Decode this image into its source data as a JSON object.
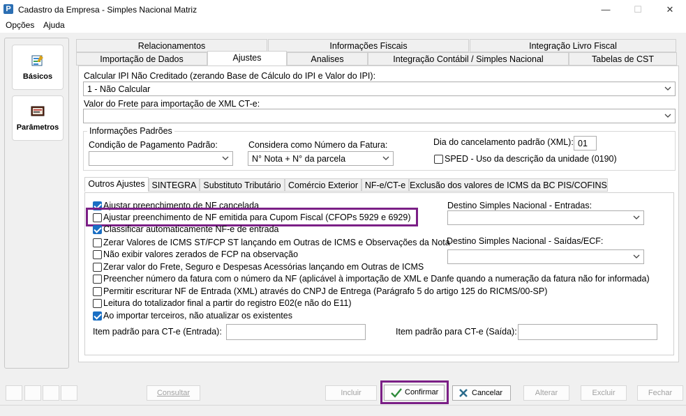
{
  "window": {
    "title": "Cadastro da Empresa - Simples Nacional Matriz",
    "app_icon": "P",
    "minimize_glyph": "—",
    "maximize_glyph": "☐",
    "close_glyph": "✕"
  },
  "menu": [
    "Opções",
    "Ajuda"
  ],
  "sidebar": {
    "items": [
      {
        "label": "Básicos",
        "icon": "form-icon"
      },
      {
        "label": "Parâmetros",
        "icon": "settings-board-icon"
      }
    ]
  },
  "tabs": {
    "row1": [
      "Relacionamentos",
      "Informações Fiscais",
      "Integração Livro Fiscal"
    ],
    "row2": [
      "Importação de Dados",
      "Ajustes",
      "Analises",
      "Integração Contábil / Simples Nacional",
      "Tabelas de CST"
    ],
    "active": "Ajustes"
  },
  "ajustes": {
    "ipi_label": "Calcular IPI Não Creditado (zerando Base de Cálculo do IPI e Valor do IPI):",
    "ipi_value": "1 - Não Calcular",
    "frete_label": "Valor do Frete para importação de XML CT-e:",
    "frete_value": "",
    "info_padroes": {
      "title": "Informações Padrões",
      "cond_pag_label": "Condição de Pagamento Padrão:",
      "cond_pag_value": "",
      "num_fatura_label": "Considera como Número da Fatura:",
      "num_fatura_value": "N° Nota + N° da parcela",
      "dia_cancel_label": "Dia do cancelamento padrão (XML):",
      "dia_cancel_value": "01",
      "sped_label": "SPED - Uso da descrição da unidade (0190)",
      "sped_checked": false
    },
    "subtabs": [
      "Outros Ajustes",
      "SINTEGRA",
      "Substituto Tributário",
      "Comércio Exterior",
      "NF-e/CT-e",
      "Exclusão dos valores de ICMS da BC PIS/COFINS"
    ],
    "subtab_active": "Outros Ajustes",
    "outros_ajustes": {
      "checks": [
        {
          "label": "Ajustar preenchimento de NF cancelada",
          "checked": true
        },
        {
          "label": "Ajustar preenchimento de NF emitida para Cupom Fiscal (CFOPs 5929 e 6929)",
          "checked": false
        },
        {
          "label": "Classificar automaticamente NF-e de entrada",
          "checked": true
        },
        {
          "label": "Zerar Valores de ICMS ST/FCP ST lançando em Outras de ICMS e Observações da Nota",
          "checked": false
        },
        {
          "label": "Não exibir valores zerados de FCP na observação",
          "checked": false
        },
        {
          "label": "Zerar valor do Frete, Seguro e Despesas Acessórias lançando em Outras de ICMS",
          "checked": false
        },
        {
          "label": "Preencher número da fatura com o número da NF (aplicável à importação de XML e Danfe quando a numeração da fatura não for informada)",
          "checked": false
        },
        {
          "label": "Permitir escriturar NF de Entrada (XML) através do CNPJ de Entrega (Parágrafo 5 do artigo 125 do RICMS/00-SP)",
          "checked": false
        },
        {
          "label": "Leitura do totalizador final a partir do registro E02(e não do E11)",
          "checked": false
        },
        {
          "label": "Ao importar terceiros, não atualizar os existentes",
          "checked": true
        }
      ],
      "destino_entradas_label": "Destino Simples Nacional - Entradas:",
      "destino_entradas_value": "",
      "destino_saidas_label": "Destino Simples Nacional - Saídas/ECF:",
      "destino_saidas_value": "",
      "item_cte_entrada_label": "Item padrão para CT-e (Entrada):",
      "item_cte_entrada_value": "",
      "item_cte_saida_label": "Item padrão para CT-e (Saída):",
      "item_cte_saida_value": ""
    }
  },
  "buttons": {
    "consultar": "Consultar",
    "incluir": "Incluir",
    "confirmar": "Confirmar",
    "cancelar": "Cancelar",
    "alterar": "Alterar",
    "excluir": "Excluir",
    "fechar": "Fechar"
  },
  "colors": {
    "highlight": "#7b1f86",
    "check_on": "#1a6fc4"
  }
}
